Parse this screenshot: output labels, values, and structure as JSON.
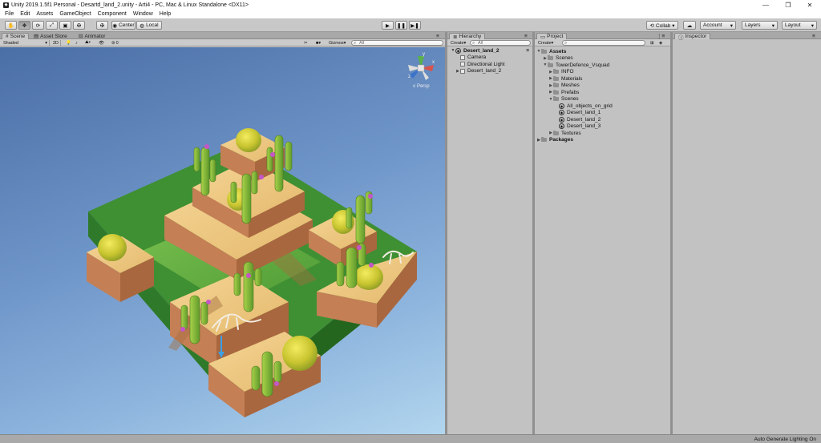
{
  "window": {
    "title": "Unity 2019.1.5f1 Personal - Desartd_land_2.unity - Arti4 - PC, Mac & Linux Standalone <DX11>",
    "minimize": "—",
    "maximize": "❐",
    "close": "✕"
  },
  "menu": [
    "File",
    "Edit",
    "Assets",
    "GameObject",
    "Component",
    "Window",
    "Help"
  ],
  "toolbar": {
    "tools": [
      "✋",
      "✥",
      "⟳",
      "⤢",
      "▣",
      "✠"
    ],
    "pivot": "Center",
    "space": "Local",
    "play": "▶",
    "pause": "❚❚",
    "step": "▶❚",
    "collab": "Collab ▾",
    "account": "Account",
    "layers": "Layers",
    "layout": "Layout"
  },
  "scene_panel": {
    "tabs": [
      "Scene",
      "Asset Store",
      "Animator"
    ],
    "shading": "Shaded",
    "mode2d": "2D",
    "effects_count": "0",
    "gizmos": "Gizmos",
    "search_placeholder": "All",
    "persp": "Persp",
    "axes": {
      "y": "y",
      "x": "x",
      "z": "z"
    }
  },
  "hierarchy": {
    "tab": "Hierarchy",
    "create": "Create",
    "search_placeholder": "All",
    "scene_name": "Desert_land_2",
    "items": [
      "Camera",
      "Directional Light",
      "Desert_land_2"
    ]
  },
  "project": {
    "tab": "Project",
    "create": "Create",
    "items": [
      {
        "label": "Assets",
        "depth": 0,
        "bold": true,
        "open": true
      },
      {
        "label": "Scenes",
        "depth": 1,
        "bold": false,
        "open": false
      },
      {
        "label": "TowerDefence_Vsquad",
        "depth": 1,
        "bold": false,
        "open": true
      },
      {
        "label": "INFO",
        "depth": 2,
        "bold": false,
        "open": false
      },
      {
        "label": "Materials",
        "depth": 2,
        "bold": false,
        "open": false
      },
      {
        "label": "Meshes",
        "depth": 2,
        "bold": false,
        "open": false
      },
      {
        "label": "Prefabs",
        "depth": 2,
        "bold": false,
        "open": false
      },
      {
        "label": "Scenes",
        "depth": 2,
        "bold": false,
        "open": true
      },
      {
        "label": "All_objects_on_grid",
        "depth": 3,
        "bold": false,
        "file": true
      },
      {
        "label": "Desert_land_1",
        "depth": 3,
        "bold": false,
        "file": true
      },
      {
        "label": "Desert_land_2",
        "depth": 3,
        "bold": false,
        "file": true
      },
      {
        "label": "Desert_land_3",
        "depth": 3,
        "bold": false,
        "file": true
      },
      {
        "label": "Textures",
        "depth": 2,
        "bold": false,
        "open": false
      },
      {
        "label": "Packages",
        "depth": 0,
        "bold": true,
        "open": false
      }
    ]
  },
  "inspector": {
    "tab": "Inspector"
  },
  "status": "Auto Generate Lighting On"
}
